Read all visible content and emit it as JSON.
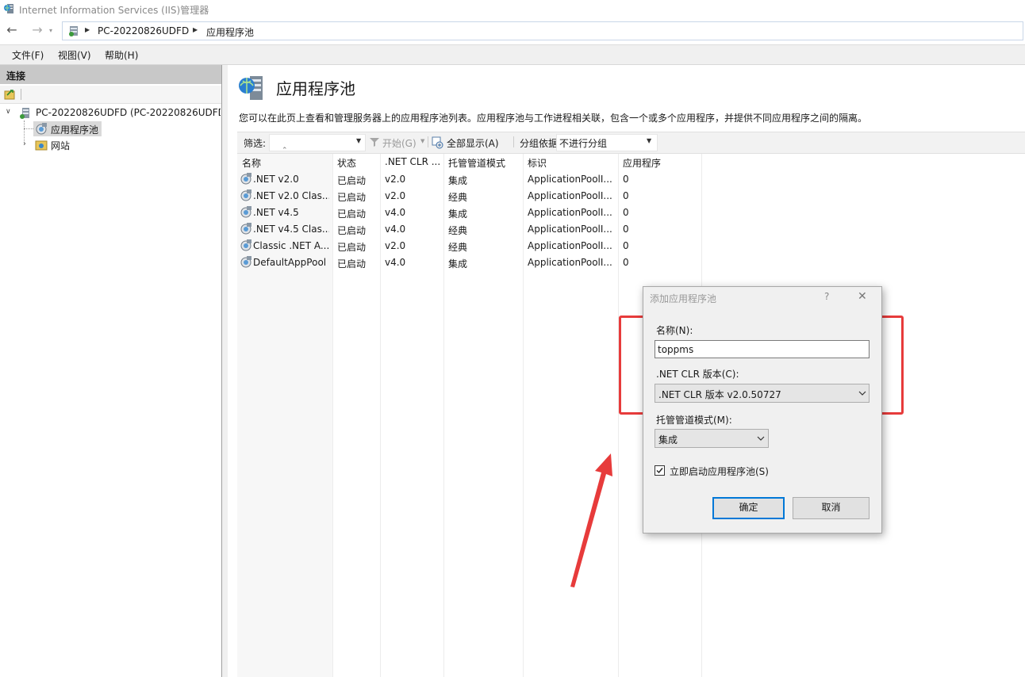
{
  "window": {
    "title": "Internet Information Services (IIS)管理器"
  },
  "address": {
    "crumbs": [
      "PC-20220826UDFD",
      "应用程序池"
    ]
  },
  "menu": {
    "items": [
      "文件(F)",
      "视图(V)",
      "帮助(H)"
    ]
  },
  "connections": {
    "header": "连接",
    "tree": {
      "server": "PC-20220826UDFD (PC-20220826UDFD\\",
      "app_pools": "应用程序池",
      "sites": "网站"
    }
  },
  "main": {
    "title": "应用程序池",
    "description": "您可以在此页上查看和管理服务器上的应用程序池列表。应用程序池与工作进程相关联，包含一个或多个应用程序，并提供不同应用程序之间的隔离。",
    "filter": {
      "label": "筛选:",
      "start": "开始(G)",
      "show_all": "全部显示(A)",
      "group_by_label": "分组依据:",
      "group_by_value": "不进行分组"
    },
    "columns": [
      "名称",
      "状态",
      ".NET CLR ...",
      "托管管道模式",
      "标识",
      "应用程序"
    ],
    "rows": [
      [
        ".NET v2.0",
        "已启动",
        "v2.0",
        "集成",
        "ApplicationPoolI...",
        "0"
      ],
      [
        ".NET v2.0 Clas...",
        "已启动",
        "v2.0",
        "经典",
        "ApplicationPoolI...",
        "0"
      ],
      [
        ".NET v4.5",
        "已启动",
        "v4.0",
        "集成",
        "ApplicationPoolI...",
        "0"
      ],
      [
        ".NET v4.5 Clas...",
        "已启动",
        "v4.0",
        "经典",
        "ApplicationPoolI...",
        "0"
      ],
      [
        "Classic .NET A...",
        "已启动",
        "v2.0",
        "经典",
        "ApplicationPoolI...",
        "0"
      ],
      [
        "DefaultAppPool",
        "已启动",
        "v4.0",
        "集成",
        "ApplicationPoolI...",
        "0"
      ]
    ]
  },
  "dialog": {
    "title": "添加应用程序池",
    "help": "?",
    "close": "✕",
    "name_label": "名称(N):",
    "name_value": "toppms",
    "clr_label": ".NET CLR 版本(C):",
    "clr_value": ".NET CLR 版本 v2.0.50727",
    "pipeline_label": "托管管道模式(M):",
    "pipeline_value": "集成",
    "start_now_label": "立即启动应用程序池(S)",
    "start_now_checked": true,
    "ok": "确定",
    "cancel": "取消"
  },
  "annotations": {
    "highlight_color": "#e73b3b"
  }
}
